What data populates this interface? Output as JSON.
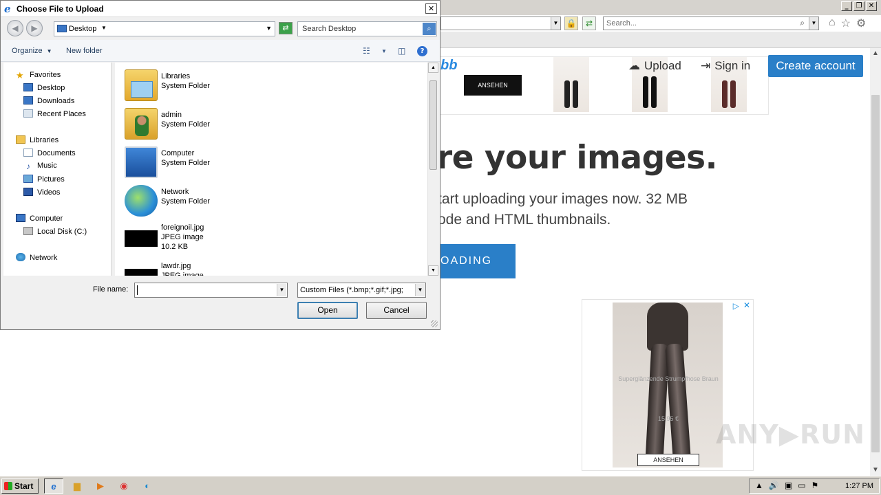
{
  "browser": {
    "search_placeholder": "Search...",
    "win_buttons": [
      "_",
      "❐",
      "✕"
    ],
    "site": {
      "logo_fragment": "bb",
      "nav": {
        "upload": "Upload",
        "sign_in": "Sign in",
        "create_account": "Create account"
      },
      "hero": {
        "title": "re your images.",
        "line1": "tart uploading your images now. 32 MB",
        "line2": "ode and HTML thumbnails.",
        "button": "OADING"
      },
      "ad_banner": {
        "button": "ANSEHEN"
      },
      "ad_box": {
        "product": "Superglänzende Strumpfhose Braun",
        "price": "15,95 €",
        "button": "ANSEHEN"
      }
    }
  },
  "watermark": "ANY▶RUN",
  "dialog": {
    "title": "Choose File to Upload",
    "location": "Desktop",
    "search_placeholder": "Search Desktop",
    "toolbar": {
      "organize": "Organize",
      "new_folder": "New folder"
    },
    "nav_pane": [
      {
        "label": "Favorites",
        "icon": "star-icon"
      },
      {
        "label": "Desktop",
        "icon": "desktop-icon"
      },
      {
        "label": "Downloads",
        "icon": "downloads-icon"
      },
      {
        "label": "Recent Places",
        "icon": "recent-places-icon"
      },
      {
        "label": "Libraries",
        "icon": "libraries-icon"
      },
      {
        "label": "Documents",
        "icon": "documents-icon"
      },
      {
        "label": "Music",
        "icon": "music-icon"
      },
      {
        "label": "Pictures",
        "icon": "pictures-icon"
      },
      {
        "label": "Videos",
        "icon": "videos-icon"
      },
      {
        "label": "Computer",
        "icon": "computer-icon"
      },
      {
        "label": "Local Disk (C:)",
        "icon": "disk-icon"
      },
      {
        "label": "Network",
        "icon": "network-icon"
      }
    ],
    "files": [
      {
        "name": "Libraries",
        "type": "System Folder",
        "size": ""
      },
      {
        "name": "admin",
        "type": "System Folder",
        "size": ""
      },
      {
        "name": "Computer",
        "type": "System Folder",
        "size": ""
      },
      {
        "name": "Network",
        "type": "System Folder",
        "size": ""
      },
      {
        "name": "foreignoil.jpg",
        "type": "JPEG image",
        "size": "10.2 KB"
      },
      {
        "name": "lawdr.jpg",
        "type": "JPEG image",
        "size": ""
      }
    ],
    "file_name_label": "File name:",
    "file_name_value": "",
    "file_type": "Custom Files (*.bmp;*.gif;*.jpg;",
    "open_button": "Open",
    "cancel_button": "Cancel"
  },
  "taskbar": {
    "start": "Start",
    "clock": "1:27 PM"
  },
  "colors": {
    "accent": "#2a7fc8",
    "dialog_bg": "#f0f0f0"
  }
}
